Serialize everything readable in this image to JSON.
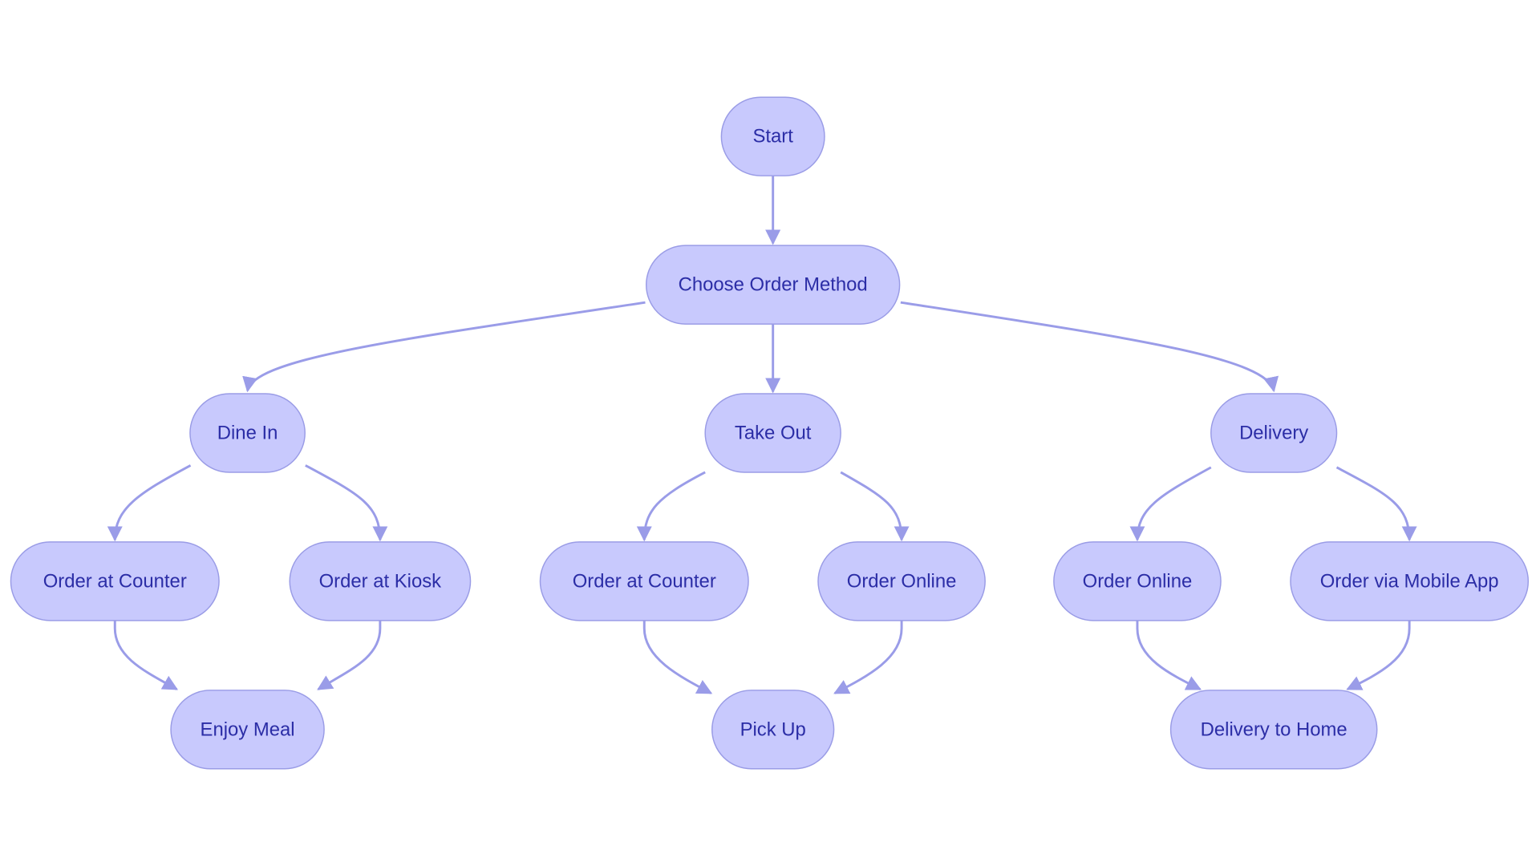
{
  "diagram": {
    "type": "flowchart",
    "colors": {
      "node_fill": "#c8c9fd",
      "node_stroke": "#9a9ce6",
      "text": "#2b2da6",
      "edge": "#9a9ce8"
    },
    "nodes": [
      {
        "id": "start",
        "label": "Start"
      },
      {
        "id": "choose",
        "label": "Choose Order Method"
      },
      {
        "id": "dine",
        "label": "Dine In"
      },
      {
        "id": "take",
        "label": "Take Out"
      },
      {
        "id": "delivery",
        "label": "Delivery"
      },
      {
        "id": "counter1",
        "label": "Order at Counter"
      },
      {
        "id": "kiosk",
        "label": "Order at Kiosk"
      },
      {
        "id": "counter2",
        "label": "Order at Counter"
      },
      {
        "id": "online1",
        "label": "Order Online"
      },
      {
        "id": "online2",
        "label": "Order Online"
      },
      {
        "id": "mobile",
        "label": "Order via Mobile App"
      },
      {
        "id": "enjoy",
        "label": "Enjoy Meal"
      },
      {
        "id": "pickup",
        "label": "Pick Up"
      },
      {
        "id": "home",
        "label": "Delivery to Home"
      }
    ],
    "edges": [
      [
        "start",
        "choose"
      ],
      [
        "choose",
        "dine"
      ],
      [
        "choose",
        "take"
      ],
      [
        "choose",
        "delivery"
      ],
      [
        "dine",
        "counter1"
      ],
      [
        "dine",
        "kiosk"
      ],
      [
        "take",
        "counter2"
      ],
      [
        "take",
        "online1"
      ],
      [
        "delivery",
        "online2"
      ],
      [
        "delivery",
        "mobile"
      ],
      [
        "counter1",
        "enjoy"
      ],
      [
        "kiosk",
        "enjoy"
      ],
      [
        "counter2",
        "pickup"
      ],
      [
        "online1",
        "pickup"
      ],
      [
        "online2",
        "home"
      ],
      [
        "mobile",
        "home"
      ]
    ]
  }
}
